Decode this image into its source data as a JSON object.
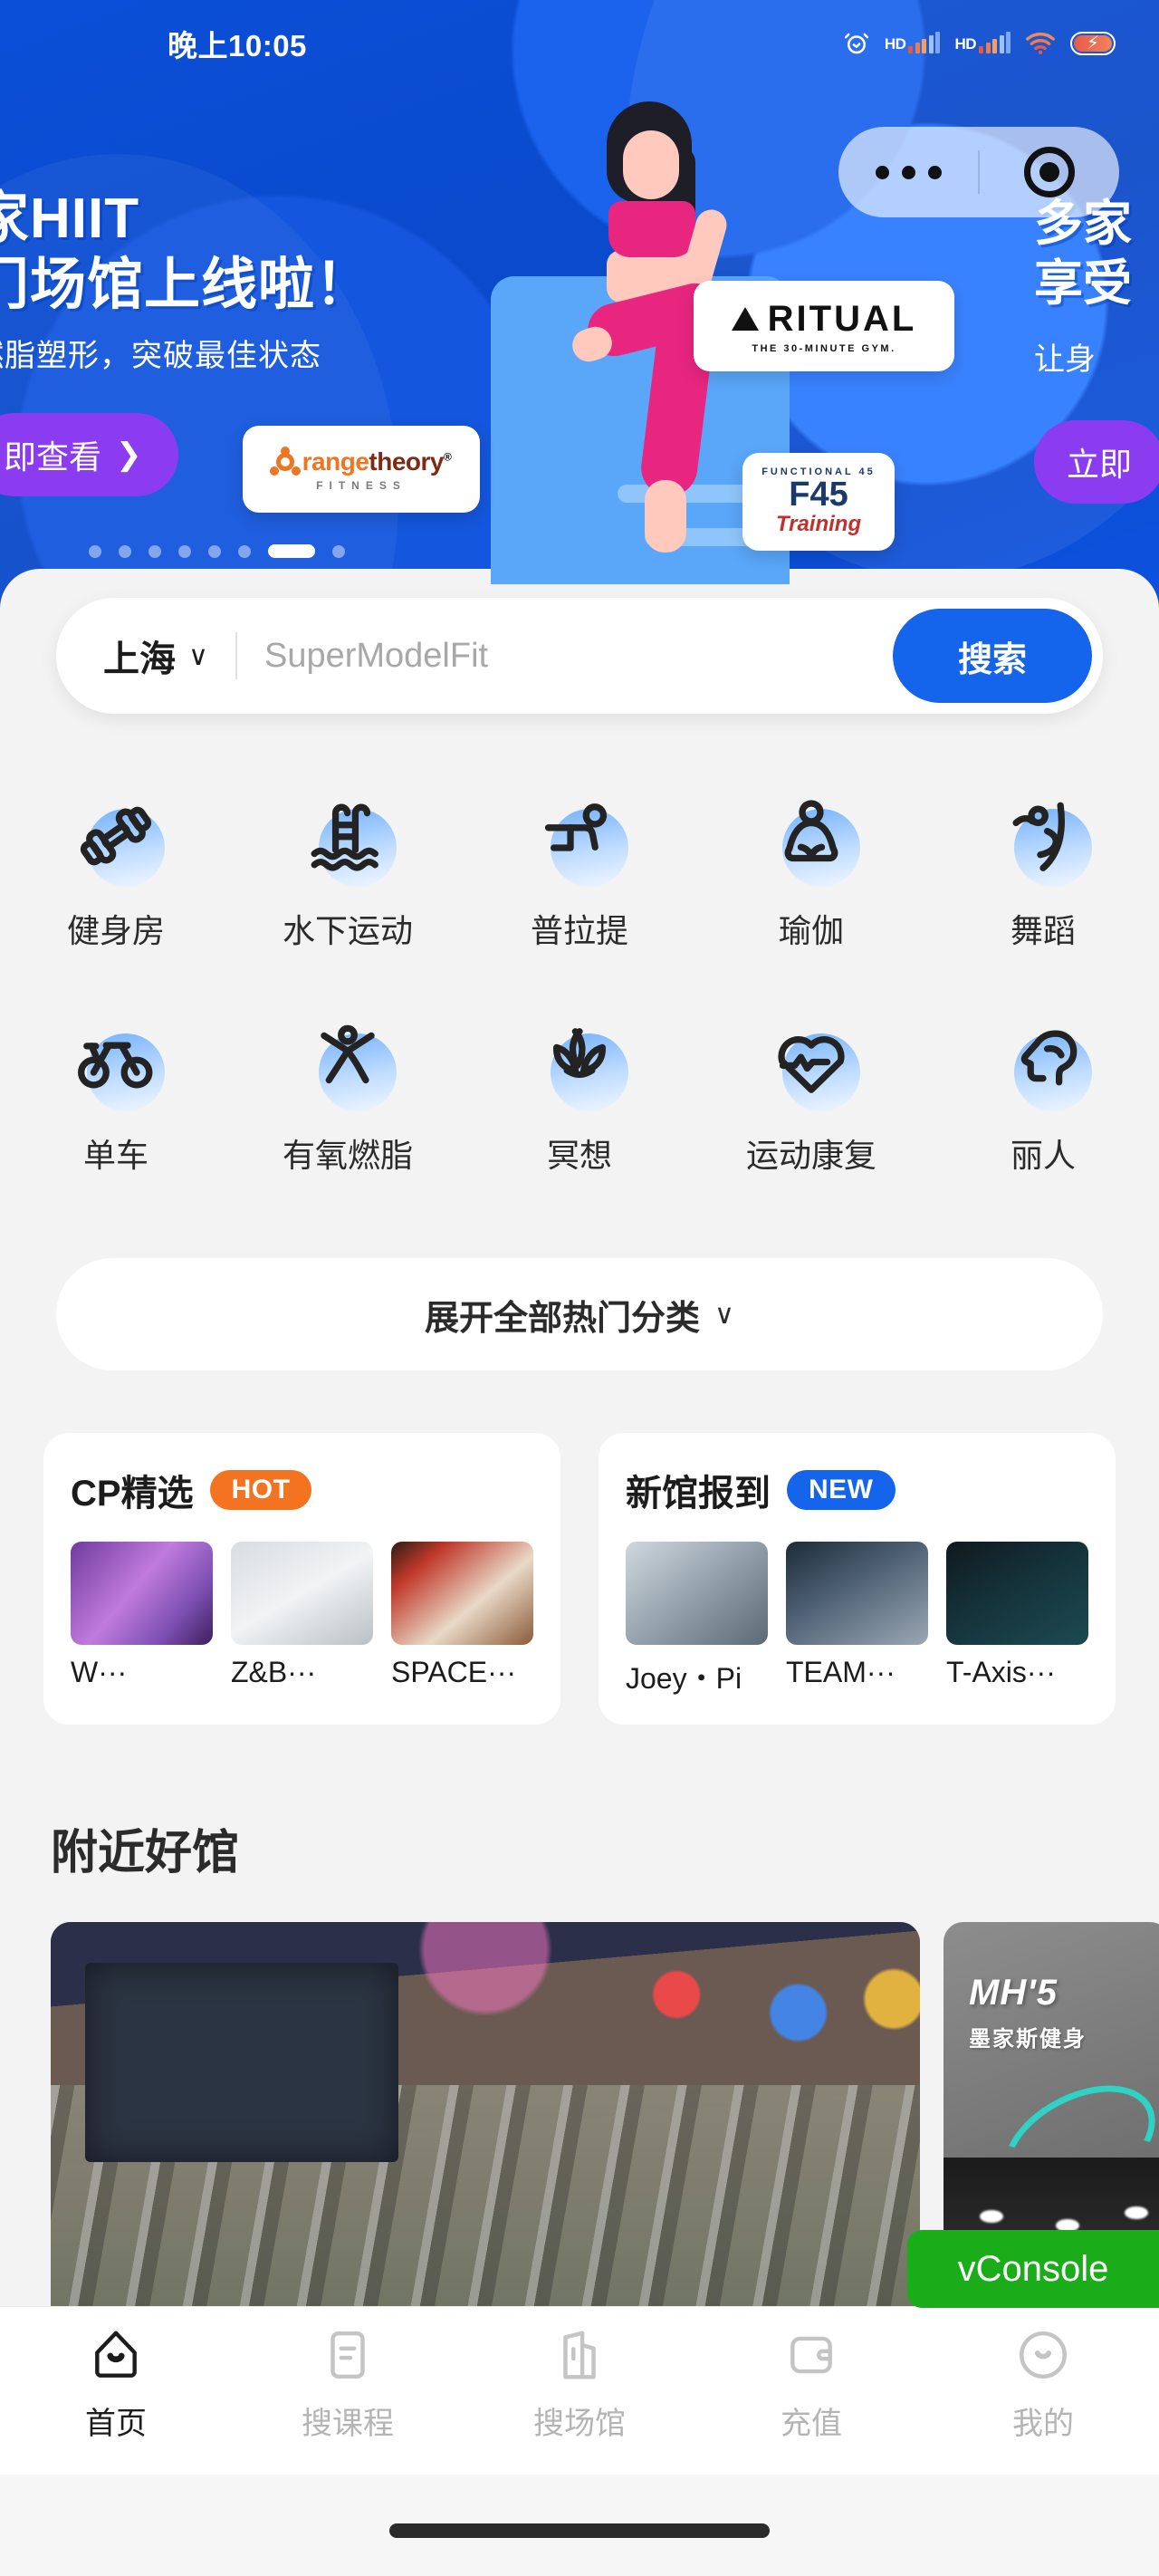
{
  "status_bar": {
    "time": "晚上10:05",
    "icons": [
      "alarm-icon",
      "hd-signal-icon",
      "hd-signal-icon",
      "wifi-icon",
      "battery-charging-icon"
    ]
  },
  "capsule": {
    "more_label": "more-icon",
    "target_label": "target-icon"
  },
  "banner": {
    "title_line1": "家HIIT",
    "title_line2": "门场馆上线啦！",
    "subtitle": "燃脂塑形，突破最佳状态",
    "cta": "即查看",
    "cta_chevron": "❯",
    "next_line1": "多家",
    "next_line2": "享受",
    "next_line3": "让身",
    "next_cta": "立即",
    "brands": [
      {
        "name": "RITUAL",
        "tagline": "THE 30-MINUTE GYM."
      },
      {
        "name": "Orangetheory",
        "tagline": "FITNESS"
      },
      {
        "name": "F45",
        "tagline": "Training",
        "arc": "FUNCTIONAL 45"
      }
    ],
    "dots_total": 8,
    "dots_active_index": 6
  },
  "search": {
    "city": "上海",
    "city_chevron": "∨",
    "placeholder": "SuperModelFit",
    "value": "",
    "button_label": "搜索"
  },
  "categories": {
    "row1": [
      {
        "label": "健身房",
        "icon": "dumbbell-icon"
      },
      {
        "label": "水下运动",
        "icon": "pool-ladder-icon"
      },
      {
        "label": "普拉提",
        "icon": "pilates-reformer-icon"
      },
      {
        "label": "瑜伽",
        "icon": "yoga-lotus-person-icon"
      },
      {
        "label": "舞蹈",
        "icon": "dancer-icon"
      }
    ],
    "row2": [
      {
        "label": "单车",
        "icon": "bicycle-icon"
      },
      {
        "label": "有氧燃脂",
        "icon": "jumping-jack-icon"
      },
      {
        "label": "冥想",
        "icon": "lotus-flower-icon"
      },
      {
        "label": "运动康复",
        "icon": "heart-pulse-icon"
      },
      {
        "label": "丽人",
        "icon": "beauty-face-icon"
      }
    ]
  },
  "expand_button": {
    "label": "展开全部热门分类",
    "chevron": "∨"
  },
  "promos": [
    {
      "title": "CP精选",
      "badge": "HOT",
      "badge_color": "#f37321",
      "items": [
        {
          "caption": "W···"
        },
        {
          "caption": "Z&B···"
        },
        {
          "caption": "SPACE···"
        }
      ]
    },
    {
      "title": "新馆报到",
      "badge": "NEW",
      "badge_color": "#1464ec",
      "items": [
        {
          "caption": "Joey・Pi"
        },
        {
          "caption": "TEAM···"
        },
        {
          "caption": "T-Axis···"
        }
      ]
    }
  ],
  "nearby": {
    "title": "附近好馆",
    "cards": [
      {
        "name": "spinning-studio-photo"
      },
      {
        "name": "MH'5",
        "subtitle": "墨家斯健身"
      }
    ]
  },
  "floating": {
    "vconsole_label": "vConsole"
  },
  "tabbar": [
    {
      "label": "首页",
      "icon": "home-icon",
      "active": true
    },
    {
      "label": "搜课程",
      "icon": "course-list-icon",
      "active": false
    },
    {
      "label": "搜场馆",
      "icon": "venue-icon",
      "active": false
    },
    {
      "label": "充值",
      "icon": "wallet-icon",
      "active": false
    },
    {
      "label": "我的",
      "icon": "profile-icon",
      "active": false
    }
  ]
}
